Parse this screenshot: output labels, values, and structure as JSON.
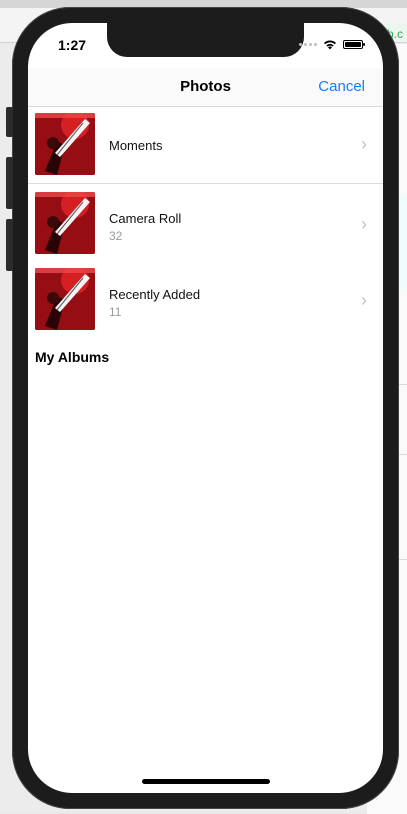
{
  "background": {
    "url_fragment": "b.c"
  },
  "status_bar": {
    "time": "1:27"
  },
  "nav": {
    "title": "Photos",
    "cancel_label": "Cancel"
  },
  "albums": [
    {
      "title": "Moments",
      "count": ""
    },
    {
      "title": "Camera Roll",
      "count": "32"
    },
    {
      "title": "Recently Added",
      "count": "11"
    }
  ],
  "section": {
    "my_albums": "My Albums"
  },
  "colors": {
    "accent": "#147efb",
    "thumb_red": "#c2121a",
    "separator": "#dedede"
  },
  "icons": {
    "row_chevron": "chevron-right-icon",
    "wifi": "wifi-icon",
    "battery": "battery-icon"
  }
}
